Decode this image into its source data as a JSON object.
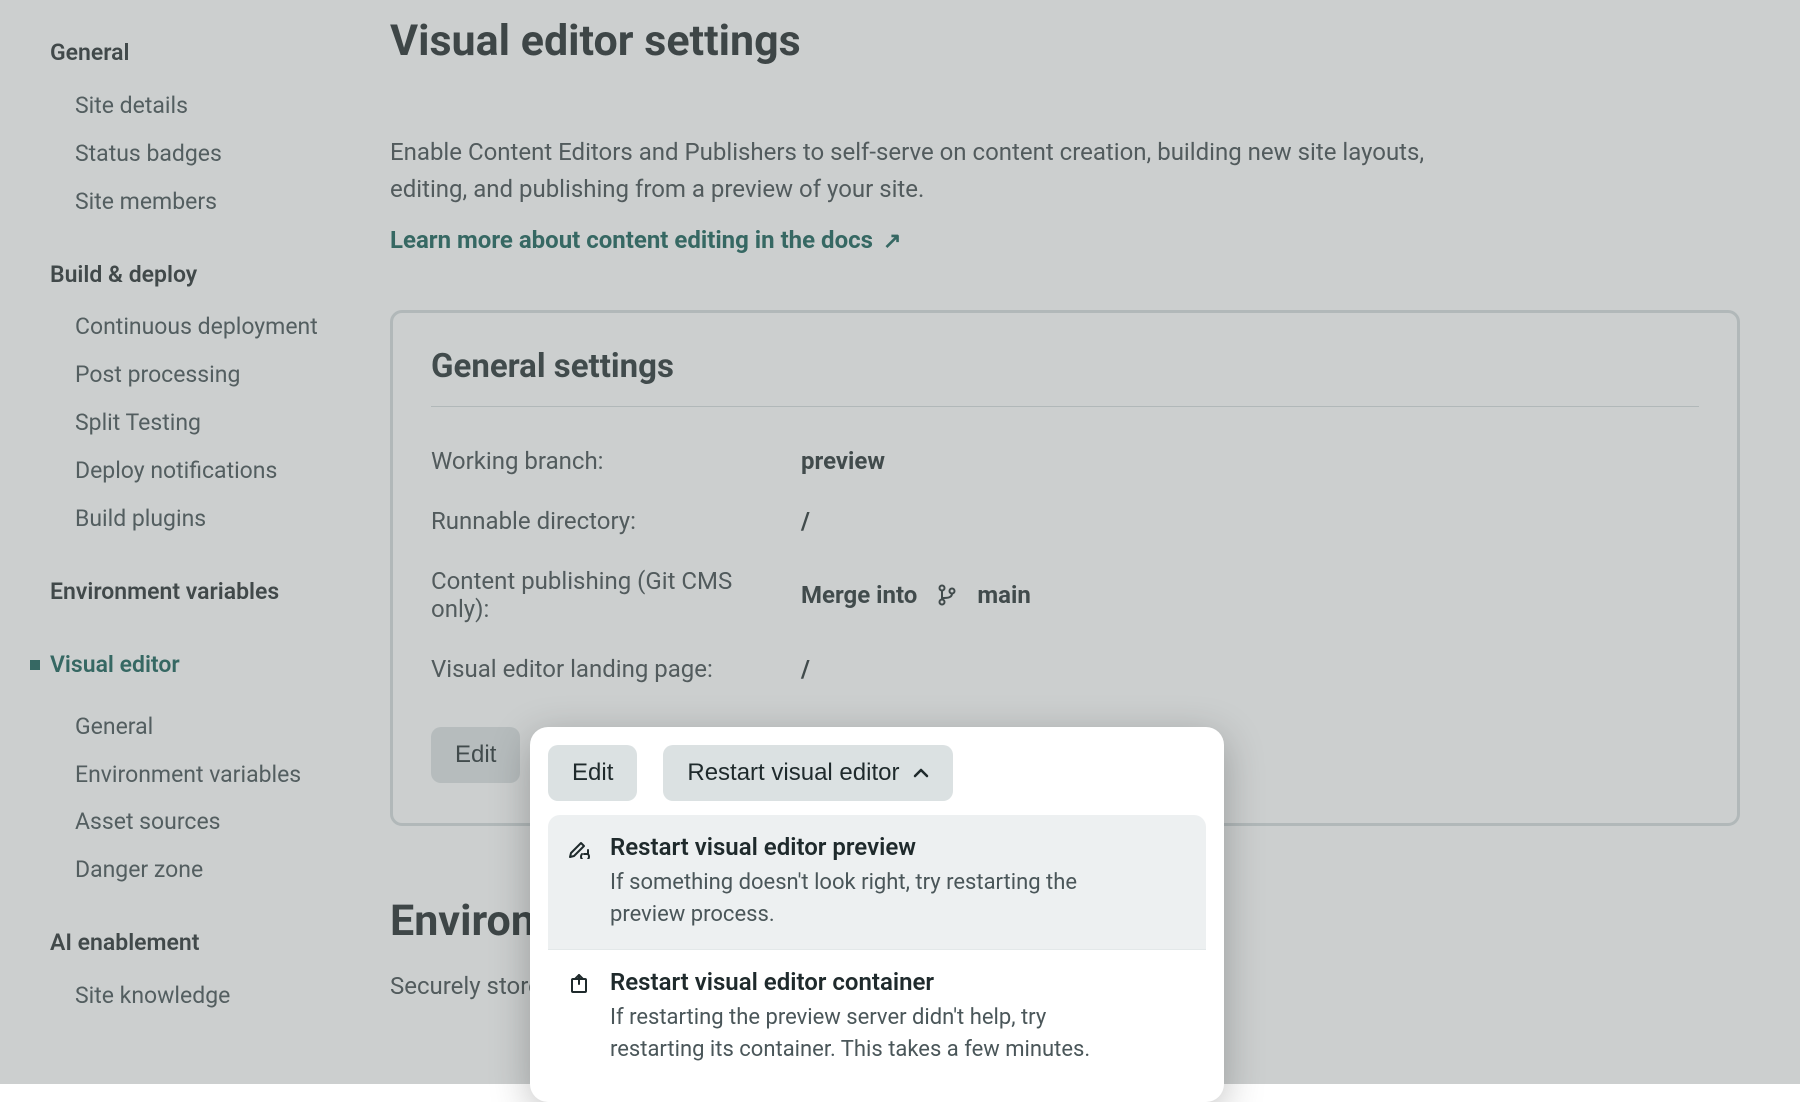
{
  "sidebar": {
    "groups": [
      {
        "title": "General",
        "items": [
          "Site details",
          "Status badges",
          "Site members"
        ]
      },
      {
        "title": "Build & deploy",
        "items": [
          "Continuous deployment",
          "Post processing",
          "Split Testing",
          "Deploy notifications",
          "Build plugins"
        ]
      },
      {
        "title": "Environment variables",
        "items": []
      }
    ],
    "active": {
      "title": "Visual editor",
      "items": [
        "General",
        "Environment variables",
        "Asset sources",
        "Danger zone"
      ]
    },
    "after": {
      "title": "AI enablement",
      "items": [
        "Site knowledge"
      ]
    }
  },
  "main": {
    "title": "Visual editor settings",
    "description": "Enable Content Editors and Publishers to self-serve on content creation, building new site layouts, editing, and publishing from a preview of your site.",
    "learn_link": "Learn more about content editing in the docs",
    "card": {
      "title": "General settings",
      "rows": {
        "working_branch_label": "Working branch:",
        "working_branch_value": "preview",
        "runnable_dir_label": "Runnable directory:",
        "runnable_dir_value": "/",
        "content_pub_label": "Content publishing (Git CMS only):",
        "content_pub_prefix": "Merge into",
        "content_pub_branch": "main",
        "landing_label": "Visual editor landing page:",
        "landing_value": "/"
      },
      "actions": {
        "edit": "Edit",
        "restart": "Restart visual editor"
      }
    },
    "env_section": {
      "title": "Environme",
      "description_full": "Securely store                                                                                                                  s for the visual editor."
    },
    "dropdown": {
      "item1": {
        "title": "Restart visual editor preview",
        "desc": "If something doesn't look right, try restarting the preview process."
      },
      "item2": {
        "title": "Restart visual editor container",
        "desc": "If restarting the preview server didn't help, try restarting its container. This takes a few minutes."
      }
    }
  }
}
